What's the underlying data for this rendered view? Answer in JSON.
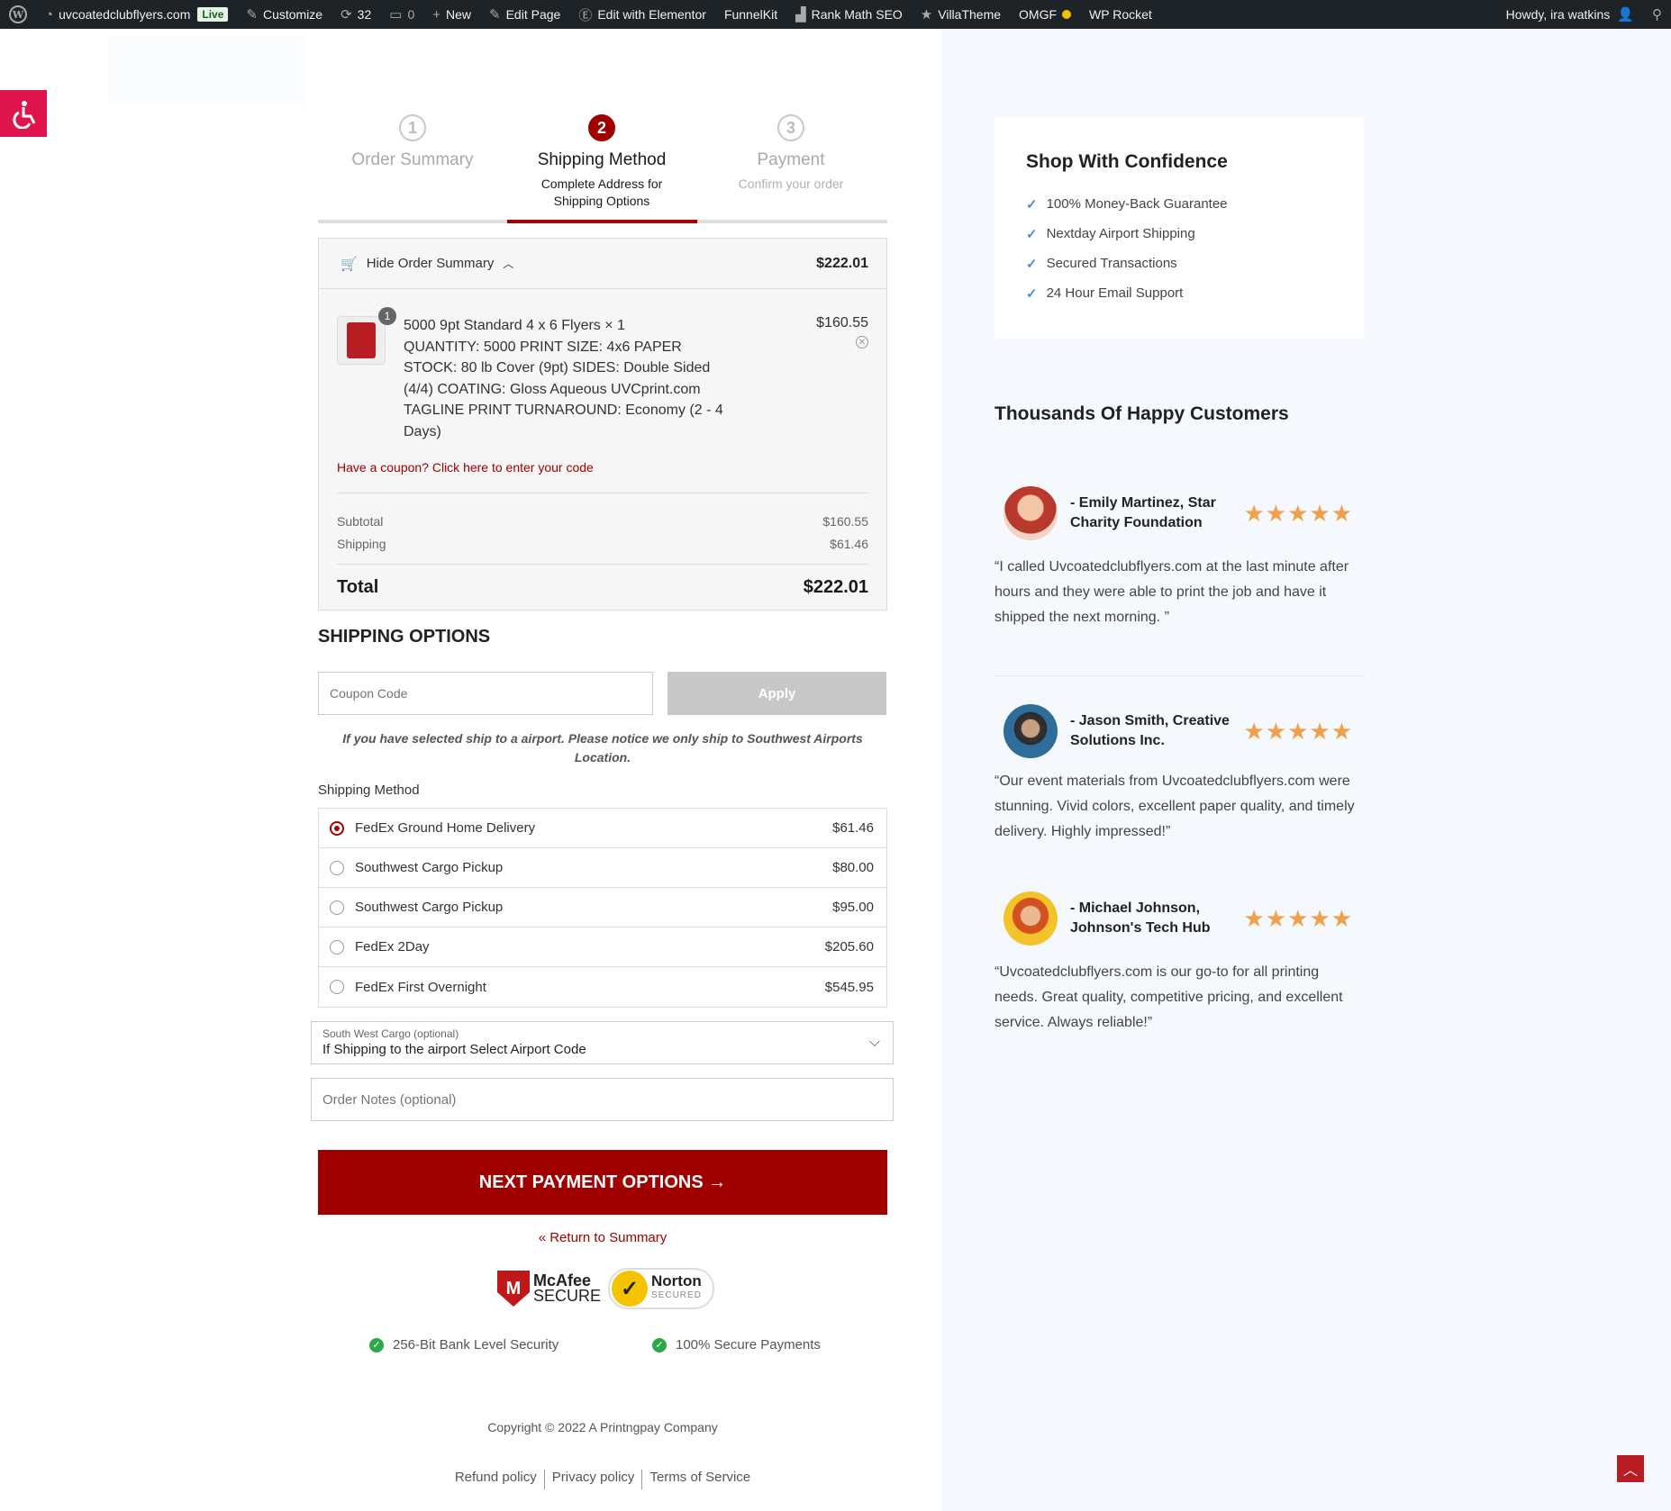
{
  "adminbar": {
    "site_name": "uvcoatedclubflyers.com",
    "live_badge": "Live",
    "customize": "Customize",
    "updates_count": "32",
    "comments_count": "0",
    "new": "New",
    "edit_page": "Edit Page",
    "edit_elementor": "Edit with Elementor",
    "funnelkit": "FunnelKit",
    "rankmath": "Rank Math SEO",
    "villatheme": "VillaTheme",
    "omgf": "OMGF",
    "wprocket": "WP Rocket",
    "howdy": "Howdy, ira watkins"
  },
  "steps": [
    {
      "num": "1",
      "title": "Order Summary",
      "sub": ""
    },
    {
      "num": "2",
      "title": "Shipping Method",
      "sub": "Complete Address for Shipping Options"
    },
    {
      "num": "3",
      "title": "Payment",
      "sub": "Confirm your order"
    }
  ],
  "summary": {
    "toggle_label": "Hide Order Summary",
    "header_total": "$222.01",
    "qty_badge": "1",
    "product_name": "5000 9pt Standard 4 x 6 Flyers × 1",
    "product_details": "QUANTITY: 5000   PRINT SIZE: 4x6   PAPER STOCK: 80 lb Cover (9pt)   SIDES: Double Sided (4/4) COATING: Gloss Aqueous UVCprint.com  TAGLINE  PRINT TURNAROUND: Economy   (2 - 4 Days)",
    "product_price": "$160.55",
    "coupon_link": "Have a coupon? Click here to enter your code",
    "subtotal_label": "Subtotal",
    "subtotal_value": "$160.55",
    "shipping_label": "Shipping",
    "shipping_value": "$61.46",
    "total_label": "Total",
    "total_value": "$222.01"
  },
  "shipping": {
    "heading": "SHIPPING OPTIONS",
    "coupon_placeholder": "Coupon Code",
    "apply_label": "Apply",
    "airport_note": "If you have selected ship to a airport. Please notice we only ship to Southwest Airports Location.",
    "method_label": "Shipping Method",
    "methods": [
      {
        "name": "FedEx Ground Home Delivery",
        "price": "$61.46"
      },
      {
        "name": "Southwest Cargo Pickup",
        "price": "$80.00"
      },
      {
        "name": "Southwest Cargo Pickup",
        "price": "$95.00"
      },
      {
        "name": "FedEx 2Day",
        "price": "$205.60"
      },
      {
        "name": "FedEx First Overnight",
        "price": "$545.95"
      }
    ],
    "selected_method": "FedEx Ground Home Delivery",
    "swc_label": "South West Cargo (optional)",
    "swc_value": "If Shipping to the airport Select Airport Code",
    "notes_placeholder": "Order Notes (optional)",
    "next_button": "NEXT PAYMENT OPTIONS →",
    "return_link": "« Return to Summary"
  },
  "security": {
    "mcafee_line1": "McAfee",
    "mcafee_line2": "SECURE",
    "norton_line1": "Norton",
    "norton_line2": "SECURED",
    "item1": "256-Bit Bank Level Security",
    "item2": "100% Secure Payments"
  },
  "footer": {
    "copyright": "Copyright © 2022 A Printngpay Company",
    "links": [
      "Refund policy",
      "Privacy policy",
      "Terms of Service"
    ]
  },
  "confidence": {
    "title": "Shop With Confidence",
    "items": [
      "100% Money-Back Guarantee",
      "Nextday Airport Shipping",
      "Secured Transactions",
      "24 Hour Email Support"
    ]
  },
  "testimonials": {
    "heading": "Thousands Of  Happy Customers",
    "items": [
      {
        "name": "- Emily Martinez, Star Charity Foundation",
        "quote": "“I called Uvcoatedclubflyers.com at the last minute after hours and they were able to print the job and have it shipped the next morning. ”",
        "rating": 5
      },
      {
        "name": "- Jason Smith, Creative Solutions Inc.",
        "quote": "“Our event materials from Uvcoatedclubflyers.com were stunning. Vivid colors, excellent paper quality, and timely delivery. Highly impressed!”",
        "rating": 5
      },
      {
        "name": "- Michael Johnson, Johnson's Tech Hub",
        "quote": "“Uvcoatedclubflyers.com is our go-to for all printing needs. Great quality, competitive pricing, and excellent service. Always reliable!”",
        "rating": 5
      }
    ]
  },
  "colors": {
    "brand_red": "#a00000",
    "star": "#f0a04b",
    "check_blue": "#4a90d9",
    "check_green": "#2ba84a"
  }
}
